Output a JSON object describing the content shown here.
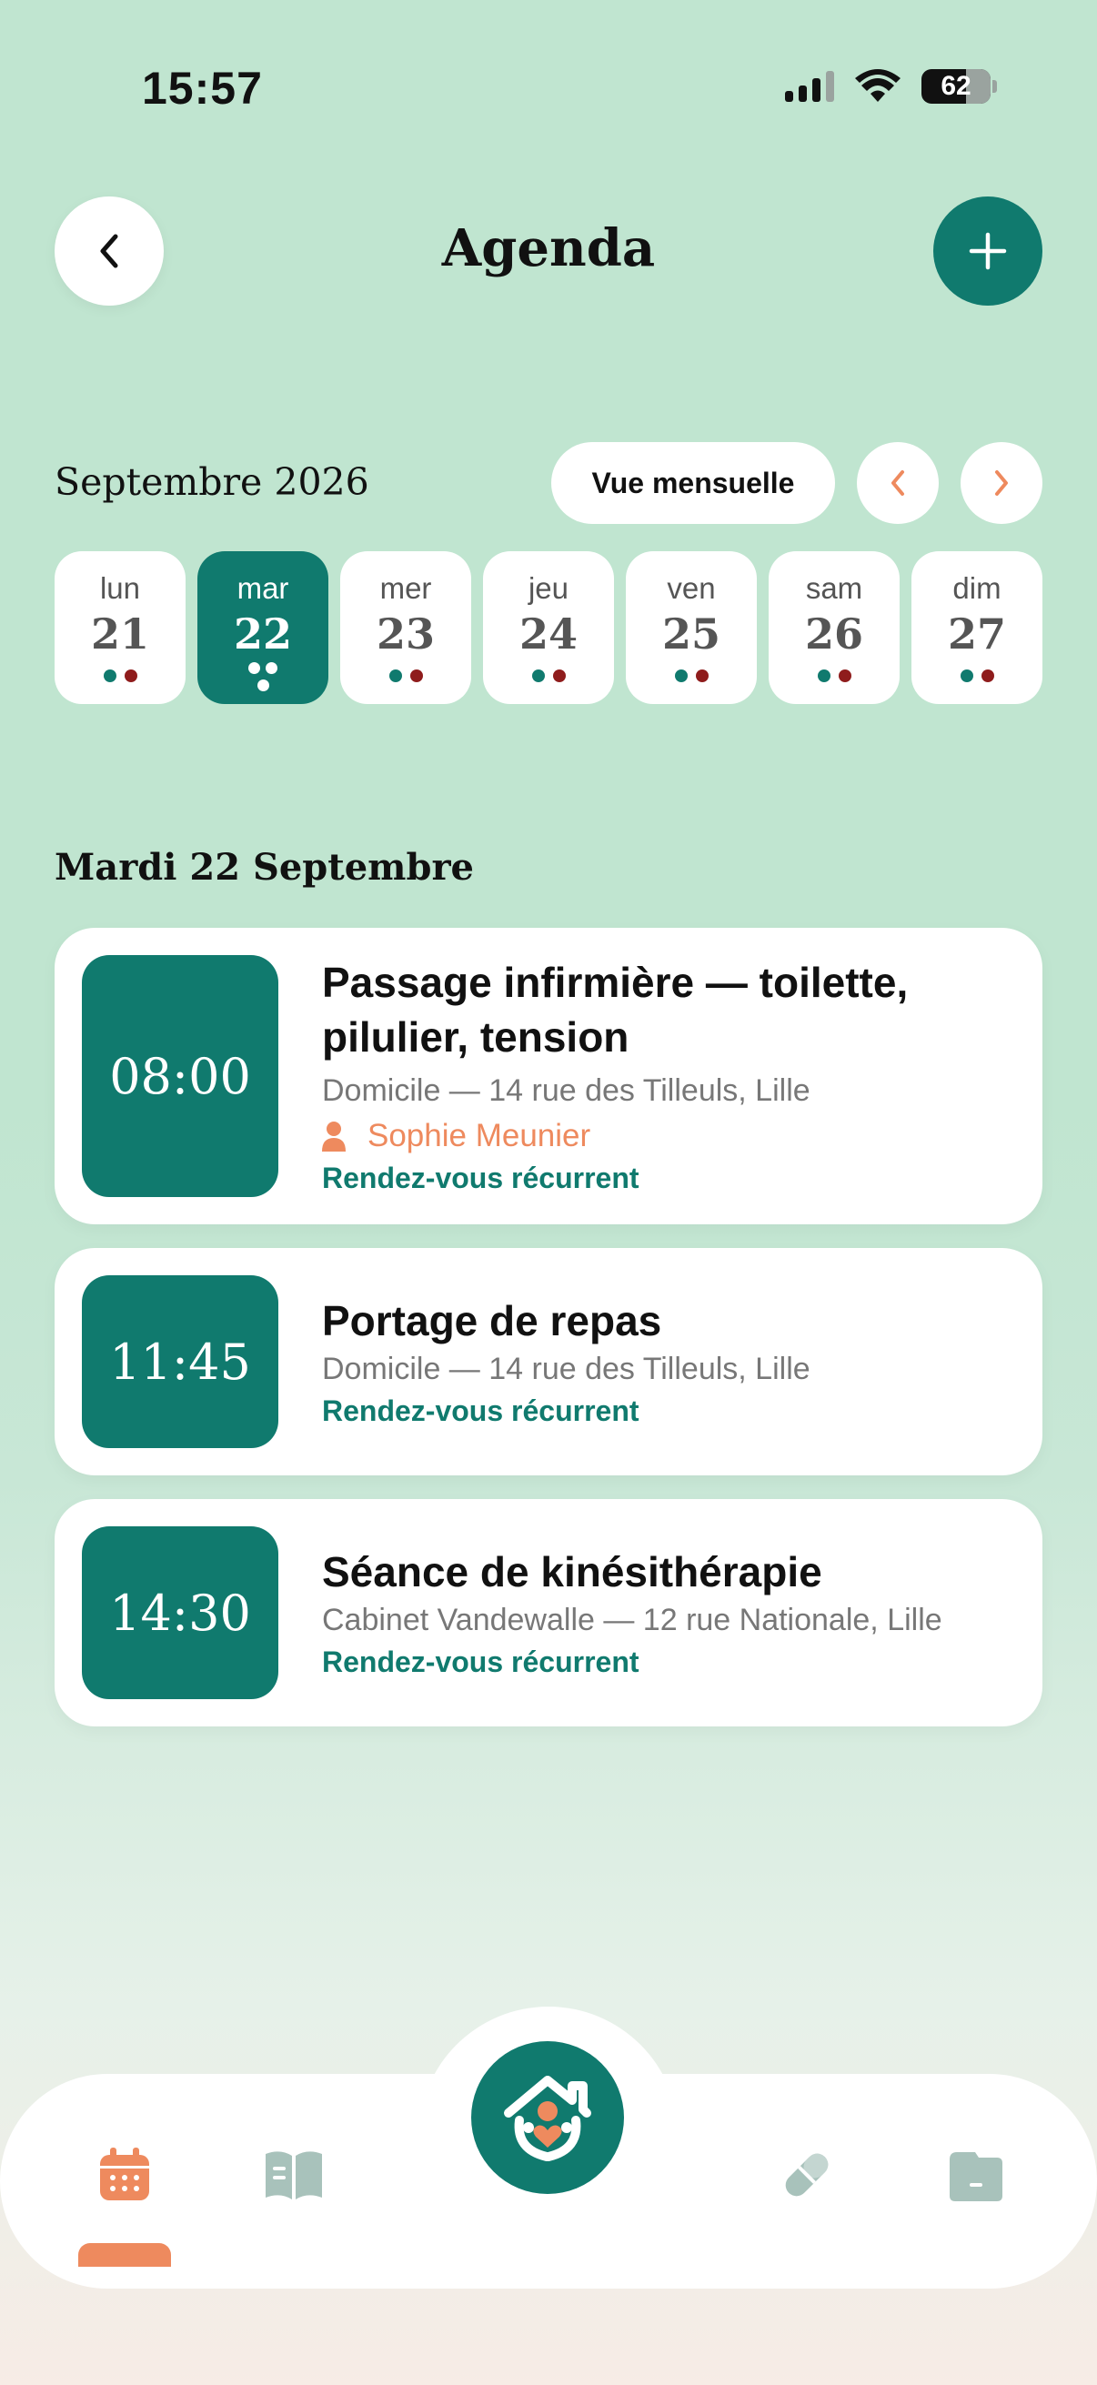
{
  "status": {
    "time": "15:57",
    "battery": "62"
  },
  "header": {
    "title": "Agenda"
  },
  "calendar": {
    "month_label": "Septembre 2026",
    "view_button": "Vue mensuelle",
    "days": [
      {
        "name": "lun",
        "num": "21"
      },
      {
        "name": "mar",
        "num": "22",
        "selected": true
      },
      {
        "name": "mer",
        "num": "23"
      },
      {
        "name": "jeu",
        "num": "24"
      },
      {
        "name": "ven",
        "num": "25"
      },
      {
        "name": "sam",
        "num": "26"
      },
      {
        "name": "dim",
        "num": "27"
      }
    ]
  },
  "section_heading": "Mardi 22 Septembre",
  "appointments": [
    {
      "time": "08:00",
      "title_line1": "Passage infirmière — toilette,",
      "title_line2": "pilulier, tension",
      "location": "Domicile — 14 rue des Tilleuls, Lille",
      "person": "Sophie Meunier",
      "recurrence": "Rendez-vous récurrent"
    },
    {
      "time": "11:45",
      "title": "Portage de repas",
      "location": "Domicile — 14 rue des Tilleuls, Lille",
      "recurrence": "Rendez-vous récurrent"
    },
    {
      "time": "14:30",
      "title": "Séance de kinésithérapie",
      "location": "Cabinet Vandewalle — 12 rue Nationale, Lille",
      "recurrence": "Rendez-vous récurrent"
    }
  ],
  "colors": {
    "accent": "#107a6e",
    "highlight": "#ee8a5e",
    "dot_secondary": "#8f1c1c",
    "background": "#c0e5d0"
  },
  "nav": {
    "items": [
      "calendar-icon",
      "book-icon",
      "home-logo",
      "pill-icon",
      "folder-icon"
    ],
    "active": "calendar-icon"
  }
}
